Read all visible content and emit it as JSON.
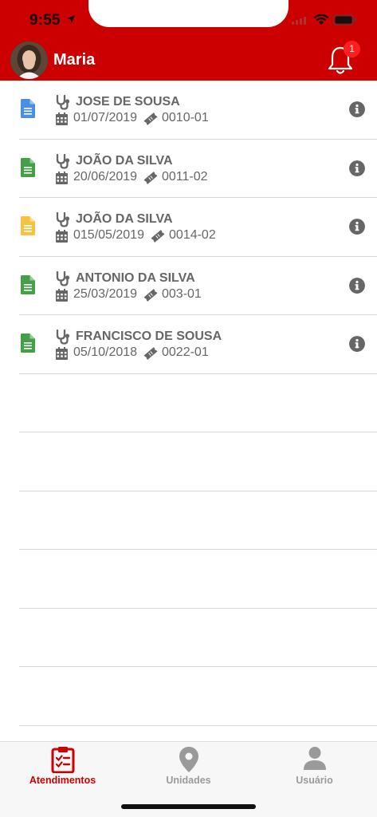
{
  "status_bar": {
    "time": "9:55"
  },
  "header": {
    "user_name": "Maria",
    "notification_count": "1"
  },
  "appointments": [
    {
      "doctor": "JOSE DE SOUSA",
      "date": "01/07/2019",
      "code": "0010-01",
      "doc_color": "#4a90e2"
    },
    {
      "doctor": "JOÃO DA SILVA",
      "date": "20/06/2019",
      "code": "0011-02",
      "doc_color": "#43a047"
    },
    {
      "doctor": "JOÃO DA SILVA",
      "date": "015/05/2019",
      "code": "0014-02",
      "doc_color": "#f5c242"
    },
    {
      "doctor": "ANTONIO DA SILVA",
      "date": "25/03/2019",
      "code": "003-01",
      "doc_color": "#43a047"
    },
    {
      "doctor": "FRANCISCO DE SOUSA",
      "date": "05/10/2018",
      "code": "0022-01",
      "doc_color": "#43a047"
    }
  ],
  "tabs": [
    {
      "label": "Atendimentos",
      "icon": "clipboard-check-icon",
      "active": true
    },
    {
      "label": "Unidades",
      "icon": "map-pin-icon",
      "active": false
    },
    {
      "label": "Usuário",
      "icon": "user-icon",
      "active": false
    }
  ],
  "colors": {
    "brand": "#cc0000",
    "text_gray": "#666666",
    "tab_inactive": "#9a9a9a"
  }
}
